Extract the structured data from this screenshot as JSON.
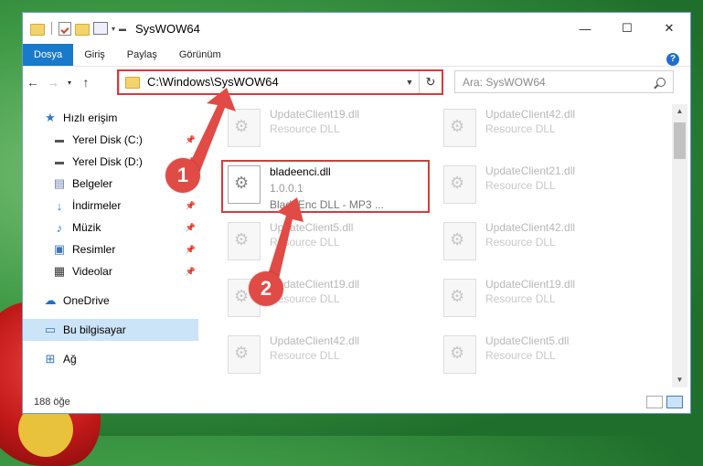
{
  "window": {
    "title": "SysWOW64",
    "controls": [
      "—",
      "☐",
      "✕"
    ]
  },
  "ribbon": {
    "tabs": [
      {
        "label": "Dosya",
        "active": true
      },
      {
        "label": "Giriş"
      },
      {
        "label": "Paylaş"
      },
      {
        "label": "Görünüm"
      }
    ],
    "help": "?"
  },
  "address": {
    "path": "C:\\Windows\\SysWOW64",
    "search_placeholder": "Ara: SysWOW64"
  },
  "sidebar": {
    "items": [
      {
        "label": "Hızlı erişim",
        "icon": "star-icon"
      },
      {
        "label": "Yerel Disk (C:)",
        "icon": "drive-icon",
        "pinned": true
      },
      {
        "label": "Yerel Disk (D:)",
        "icon": "drive-icon",
        "pinned": true
      },
      {
        "label": "Belgeler",
        "icon": "documents-icon",
        "pinned": true
      },
      {
        "label": "İndirmeler",
        "icon": "download-icon",
        "pinned": true
      },
      {
        "label": "Müzik",
        "icon": "music-icon",
        "pinned": true
      },
      {
        "label": "Resimler",
        "icon": "pictures-icon",
        "pinned": true
      },
      {
        "label": "Videolar",
        "icon": "videos-icon",
        "pinned": true
      },
      {
        "label": "OneDrive",
        "icon": "cloud-icon"
      },
      {
        "label": "Bu bilgisayar",
        "icon": "computer-icon",
        "selected": true
      },
      {
        "label": "Ağ",
        "icon": "network-icon"
      }
    ]
  },
  "files": [
    {
      "name": "UpdateClient19.dll",
      "desc": "Resource DLL"
    },
    {
      "name": "UpdateClient42.dll",
      "desc": "Resource DLL"
    },
    {
      "name": "bladeenci.dll",
      "version": "1.0.0.1",
      "desc": "BladeEnc DLL - MP3 ...",
      "highlighted": true
    },
    {
      "name": "UpdateClient21.dll",
      "desc": "Resource DLL"
    },
    {
      "name": "UpdateClient5.dll",
      "desc": "Resource DLL"
    },
    {
      "name": "UpdateClient42.dll",
      "desc": "Resource DLL"
    },
    {
      "name": "UpdateClient19.dll",
      "desc": "Resource DLL"
    },
    {
      "name": "UpdateClient19.dll",
      "desc": "Resource DLL"
    },
    {
      "name": "UpdateClient42.dll",
      "desc": "Resource DLL"
    },
    {
      "name": "UpdateClient5.dll",
      "desc": "Resource DLL"
    }
  ],
  "status": {
    "count": "188 öğe"
  },
  "annotations": {
    "step1": "1",
    "step2": "2",
    "color": "#d83a3a"
  }
}
